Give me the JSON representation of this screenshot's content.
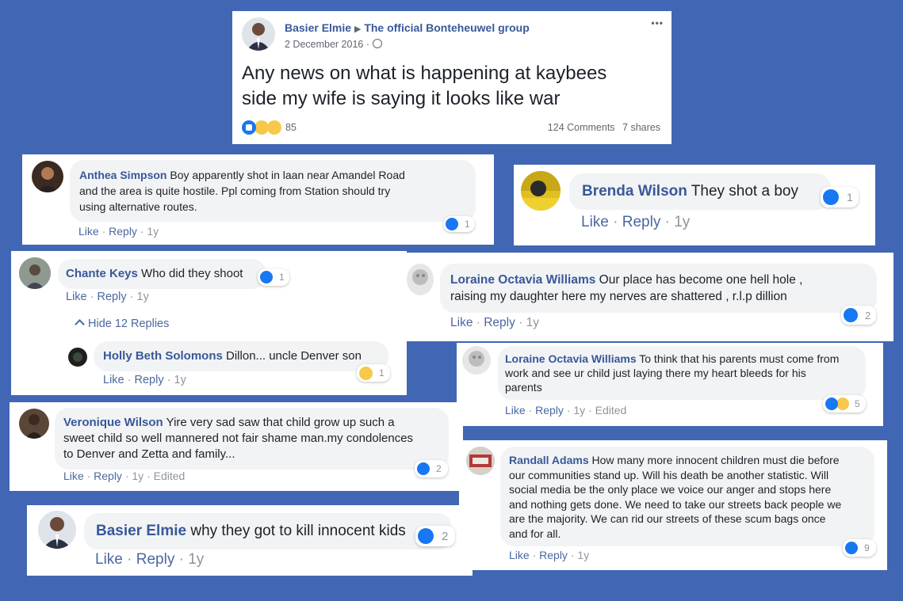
{
  "post": {
    "author": "Basier Elmie",
    "group": "The official Bonteheuwel group",
    "date": "2 December 2016",
    "menu": "•••",
    "text_line1": "Any news on what is happening at kaybees",
    "text_line2": "side my wife is saying it looks like war",
    "reaction_count": "85",
    "comments": "124 Comments",
    "shares": "7 shares",
    "reactions": [
      "like-icon",
      "sad-icon",
      "wow-icon"
    ]
  },
  "actions": {
    "like": "Like",
    "reply": "Reply",
    "dot": "·",
    "edited": "Edited"
  },
  "comments": {
    "anthea": {
      "name": "Anthea Simpson",
      "text1": "Boy apparently shot in laan near Amandel Road",
      "text2": "and the area is quite hostile. Ppl coming from Station should try",
      "text3": "using alternative routes.",
      "age": "1y",
      "count": "1"
    },
    "brenda": {
      "name": "Brenda Wilson",
      "text": "They shot a boy",
      "age": "1y",
      "count": "1"
    },
    "chante": {
      "name": "Chante Keys",
      "text": "Who did they shoot",
      "age": "1y",
      "count": "1",
      "hide_replies": "Hide 12 Replies"
    },
    "holly": {
      "name": "Holly Beth Solomons",
      "text": "Dillon... uncle Denver son",
      "age": "1y",
      "count": "1"
    },
    "loraine1": {
      "name": "Loraine Octavia Williams",
      "text1": "Our place has become one hell hole ,",
      "text2": "raising my daughter here my nerves are shattered , r.l.p dillion",
      "age": "1y",
      "count": "2"
    },
    "loraine2": {
      "name": "Loraine Octavia Williams",
      "text1": "To think that his parents must come from",
      "text2": "work and see ur child just laying there my heart bleeds for his",
      "text3": "parents",
      "age": "1y",
      "count": "5"
    },
    "veronique": {
      "name": "Veronique Wilson",
      "text1": "Yire very sad saw that child grow up such a",
      "text2": "sweet child so well mannered not fair shame man.my condolences",
      "text3": "to Denver and Zetta and family...",
      "age": "1y",
      "count": "2"
    },
    "randall": {
      "name": "Randall Adams",
      "text1": "How many more innocent children must die before",
      "text2": "our communities stand up. Will his death be another statistic. Will",
      "text3": "social media be the only place we voice our anger and stops here",
      "text4": "and nothing gets done. We need to take our streets back people we",
      "text5": "are the majority. We can rid our streets of these scum bags once",
      "text6": "and for all.",
      "age": "1y",
      "count": "9"
    },
    "basier": {
      "name": "Basier Elmie",
      "text": "why they got to kill innocent kids",
      "age": "1y",
      "count": "2"
    }
  },
  "colors": {
    "background": "#4166b4",
    "name": "#385898",
    "bubble": "#f2f3f5",
    "like": "#1877f2"
  }
}
